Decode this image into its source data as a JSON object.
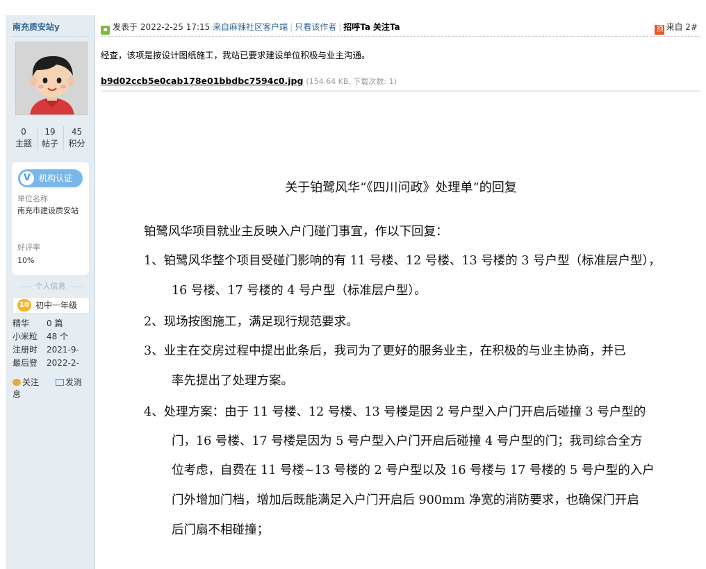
{
  "author": {
    "name": "南充质安站y",
    "stats": [
      {
        "value": "0",
        "label": "主题"
      },
      {
        "value": "19",
        "label": "帖子"
      },
      {
        "value": "45",
        "label": "积分"
      }
    ],
    "certification": {
      "badge": "机构认证",
      "unit_label": "单位名称",
      "unit_value": "南充市建设质安站",
      "rating_label": "好评率",
      "rating_value": "10%"
    },
    "info_title": "个人信息",
    "level_badge": "10",
    "level": "初中一年级",
    "fields": [
      {
        "key": "精华",
        "value": "0 篇"
      },
      {
        "key": "小米粒",
        "value": "48 个"
      },
      {
        "key": "注册时",
        "value": "2021-9-"
      },
      {
        "key": "最后登",
        "value": "2022-2-"
      }
    ],
    "follow_label": "关注",
    "message_label": "发消息"
  },
  "post": {
    "posted_at": "发表于 2022-2-25 17:15",
    "client": "来自麻辣社区客户端",
    "only_author": "只看该作者",
    "greet": "招呼Ta",
    "follow": "关注Ta",
    "floor_icon": "顶",
    "floor": "来自 2#",
    "message": "经查，该项是按设计图纸施工，我站已要求建设单位积极与业主沟通。",
    "attachment": {
      "filename": "b9d02ccb5e0cab178e01bbdbc7594c0.jpg",
      "meta": "(154.64 KB, 下载次数: 1)"
    }
  },
  "document": {
    "title": "关于铂鹭风华“《四川问政》处理单”的回复",
    "lines": [
      "铂鹭风华项目就业主反映入户门碰门事宜，作以下回复：",
      "1、铂鹭风华整个项目受碰门影响的有 11 号楼、12 号楼、13 号楼的 3 号户型（标准层户型），",
      "16 号楼、17 号楼的 4 号户型（标准层户型）。",
      "2、现场按图施工，满足现行规范要求。",
      "3、业主在交房过程中提出此条后，我司为了更好的服务业主，在积极的与业主协商，并已",
      "率先提出了处理方案。",
      "4、处理方案：由于 11 号楼、12 号楼、13 号楼是因 2 号户型入户门开启后碰撞 3 号户型的",
      "门，16 号楼、17 号楼是因为 5 号户型入户门开启后碰撞 4 号户型的门；我司综合全方",
      "位考虑，自费在 11 号楼~13 号楼的 2 号户型以及 16 号楼与 17 号楼的 5 号户型的入户",
      "门外增加门档，增加后既能满足入户门开启后 900mm 净宽的消防要求，也确保门开启",
      "后门扇不相碰撞；"
    ]
  }
}
